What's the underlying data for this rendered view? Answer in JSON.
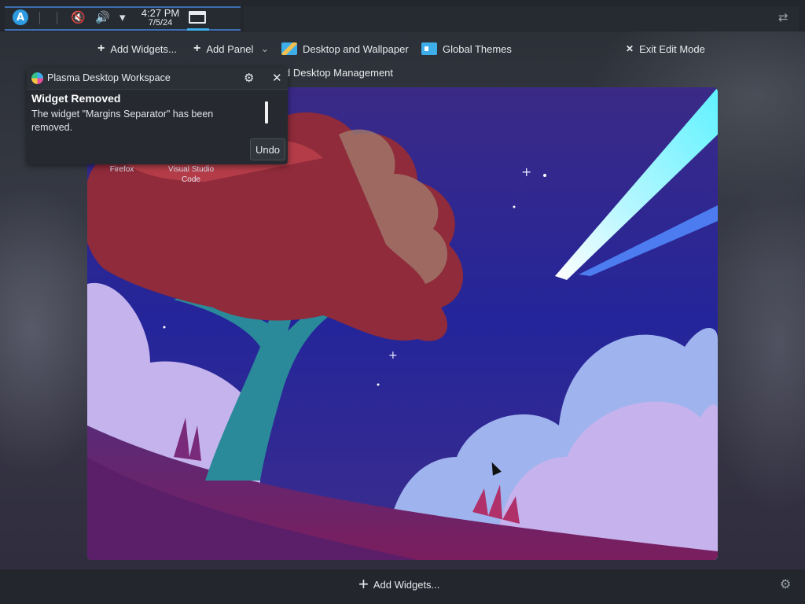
{
  "top_panel": {
    "launcher_icon": "A",
    "clock_time": "4:27 PM",
    "clock_date": "7/5/24",
    "mute_icon_glyph": "🔇",
    "volume_icon_glyph": "🔊",
    "arrow_icon_glyph": "▾",
    "config_icon_glyph": "⇄"
  },
  "edit_toolbar": {
    "add_widgets": "Add Widgets...",
    "add_panel": "Add Panel",
    "desktop_wallpaper": "Desktop and Wallpaper",
    "global_themes": "Global Themes",
    "display_mgmt_partial": "d Desktop Management",
    "exit_edit_mode": "Exit Edit Mode",
    "chevron": "⌄",
    "close_glyph": "✕",
    "plus_glyph": "+"
  },
  "desktop_icons": [
    {
      "label": "Firefox"
    },
    {
      "label": "Visual Studio Code"
    }
  ],
  "notification": {
    "app_name": "Plasma Desktop Workspace",
    "title": "Widget Removed",
    "body": "The widget \"Margins Separator\" has been removed.",
    "undo_label": "Undo",
    "gear_glyph": "⚙",
    "close_glyph": "✕"
  },
  "bottom_panel": {
    "add_widgets": "Add Widgets...",
    "plus_glyph": "+",
    "gear_glyph": "⚙"
  },
  "colors": {
    "accent": "#3daee9",
    "panel_bg": "#23262c",
    "sky": "#2b2a78"
  }
}
